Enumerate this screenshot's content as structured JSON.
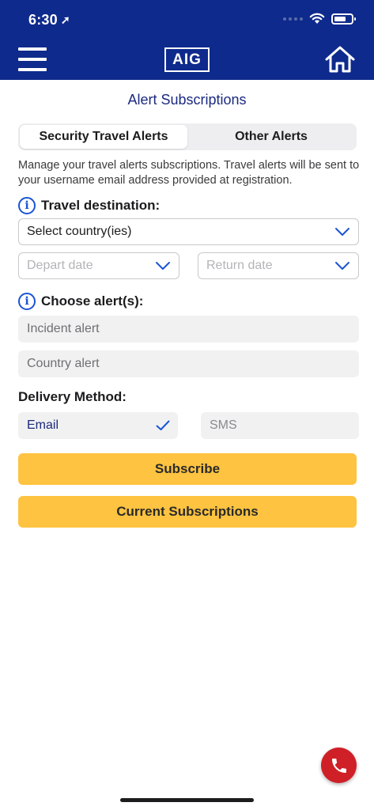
{
  "status_bar": {
    "time": "6:30",
    "location_glyph": "➚"
  },
  "header": {
    "menu_icon": "hamburger-icon",
    "logo_text": "AIG",
    "home_icon": "home-icon",
    "color": "#0e2a8c"
  },
  "page": {
    "title": "Alert Subscriptions"
  },
  "tabs": [
    {
      "label": "Security Travel Alerts",
      "active": true
    },
    {
      "label": "Other Alerts",
      "active": false
    }
  ],
  "description": "Manage your travel alerts subscriptions. Travel alerts will be sent to your username email address provided at registration.",
  "destination": {
    "label": "Travel destination:",
    "info_glyph": "i",
    "country_select": "Select country(ies)",
    "depart_placeholder": "Depart date",
    "return_placeholder": "Return date"
  },
  "alerts": {
    "label": "Choose alert(s):",
    "info_glyph": "i",
    "incident": "Incident alert",
    "country": "Country alert"
  },
  "delivery": {
    "label": "Delivery Method:",
    "options": [
      {
        "label": "Email",
        "selected": true
      },
      {
        "label": "SMS",
        "selected": false
      }
    ]
  },
  "buttons": {
    "subscribe": "Subscribe",
    "current": "Current Subscriptions",
    "color": "#fec340"
  },
  "call_button": {
    "icon": "phone-icon",
    "color": "#cf2027"
  }
}
